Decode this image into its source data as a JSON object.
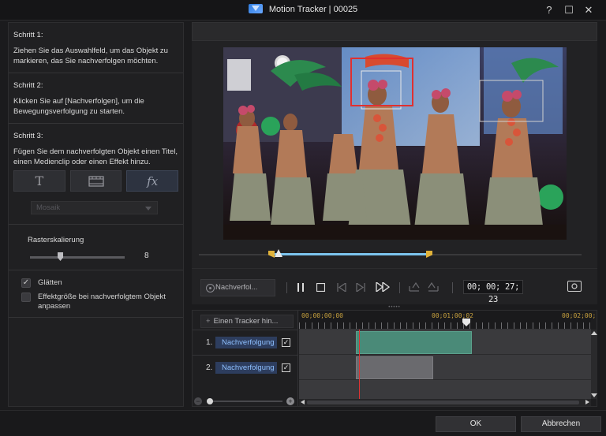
{
  "window": {
    "title": "Motion Tracker | 00025",
    "controls": {
      "help": "?",
      "maximize": "☐",
      "close": "✕"
    }
  },
  "steps": [
    {
      "heading": "Schritt 1:",
      "text": "Ziehen Sie das Auswahlfeld, um das Objekt zu markieren, das Sie nachverfolgen möchten."
    },
    {
      "heading": "Schritt 2:",
      "text": "Klicken Sie auf [Nachverfolgen], um die Bewegungsverfolgung zu starten."
    },
    {
      "heading": "Schritt 3:",
      "text": "Fügen Sie dem nachverfolgten Objekt einen Titel, einen Medienclip oder einen Effekt hinzu."
    }
  ],
  "tools": {
    "title_glyph": "T",
    "effect_glyph": "fx",
    "active": "effect"
  },
  "effect_select": {
    "value": "Mosaik"
  },
  "raster": {
    "label": "Rasterskalierung",
    "value": "8",
    "level": 0.3
  },
  "options": {
    "smooth": {
      "label": "Glätten",
      "checked": true
    },
    "adjust": {
      "label": "Effektgröße bei nachverfolgtem Objekt anpassen",
      "checked": false
    }
  },
  "transport": {
    "track_button": "Nachverfol...",
    "timecode": "00; 00; 27; 23"
  },
  "timeline": {
    "add_tracker": "Einen Tracker hin...",
    "ruler": [
      "00;00;00;00",
      "00;01;00;02",
      "00;02;00;"
    ],
    "rows": [
      {
        "num": "1.",
        "name": "Nachverfolgung",
        "checked": true
      },
      {
        "num": "2.",
        "name": "Nachverfolgung",
        "checked": true
      }
    ]
  },
  "footer": {
    "ok": "OK",
    "cancel": "Abbrechen"
  },
  "colors": {
    "accent": "#7cc4ee",
    "tracker_active": "#e03030",
    "clip1": "#4a8a78",
    "clip2": "#6a6a6e",
    "trim": "#e0b23a"
  }
}
